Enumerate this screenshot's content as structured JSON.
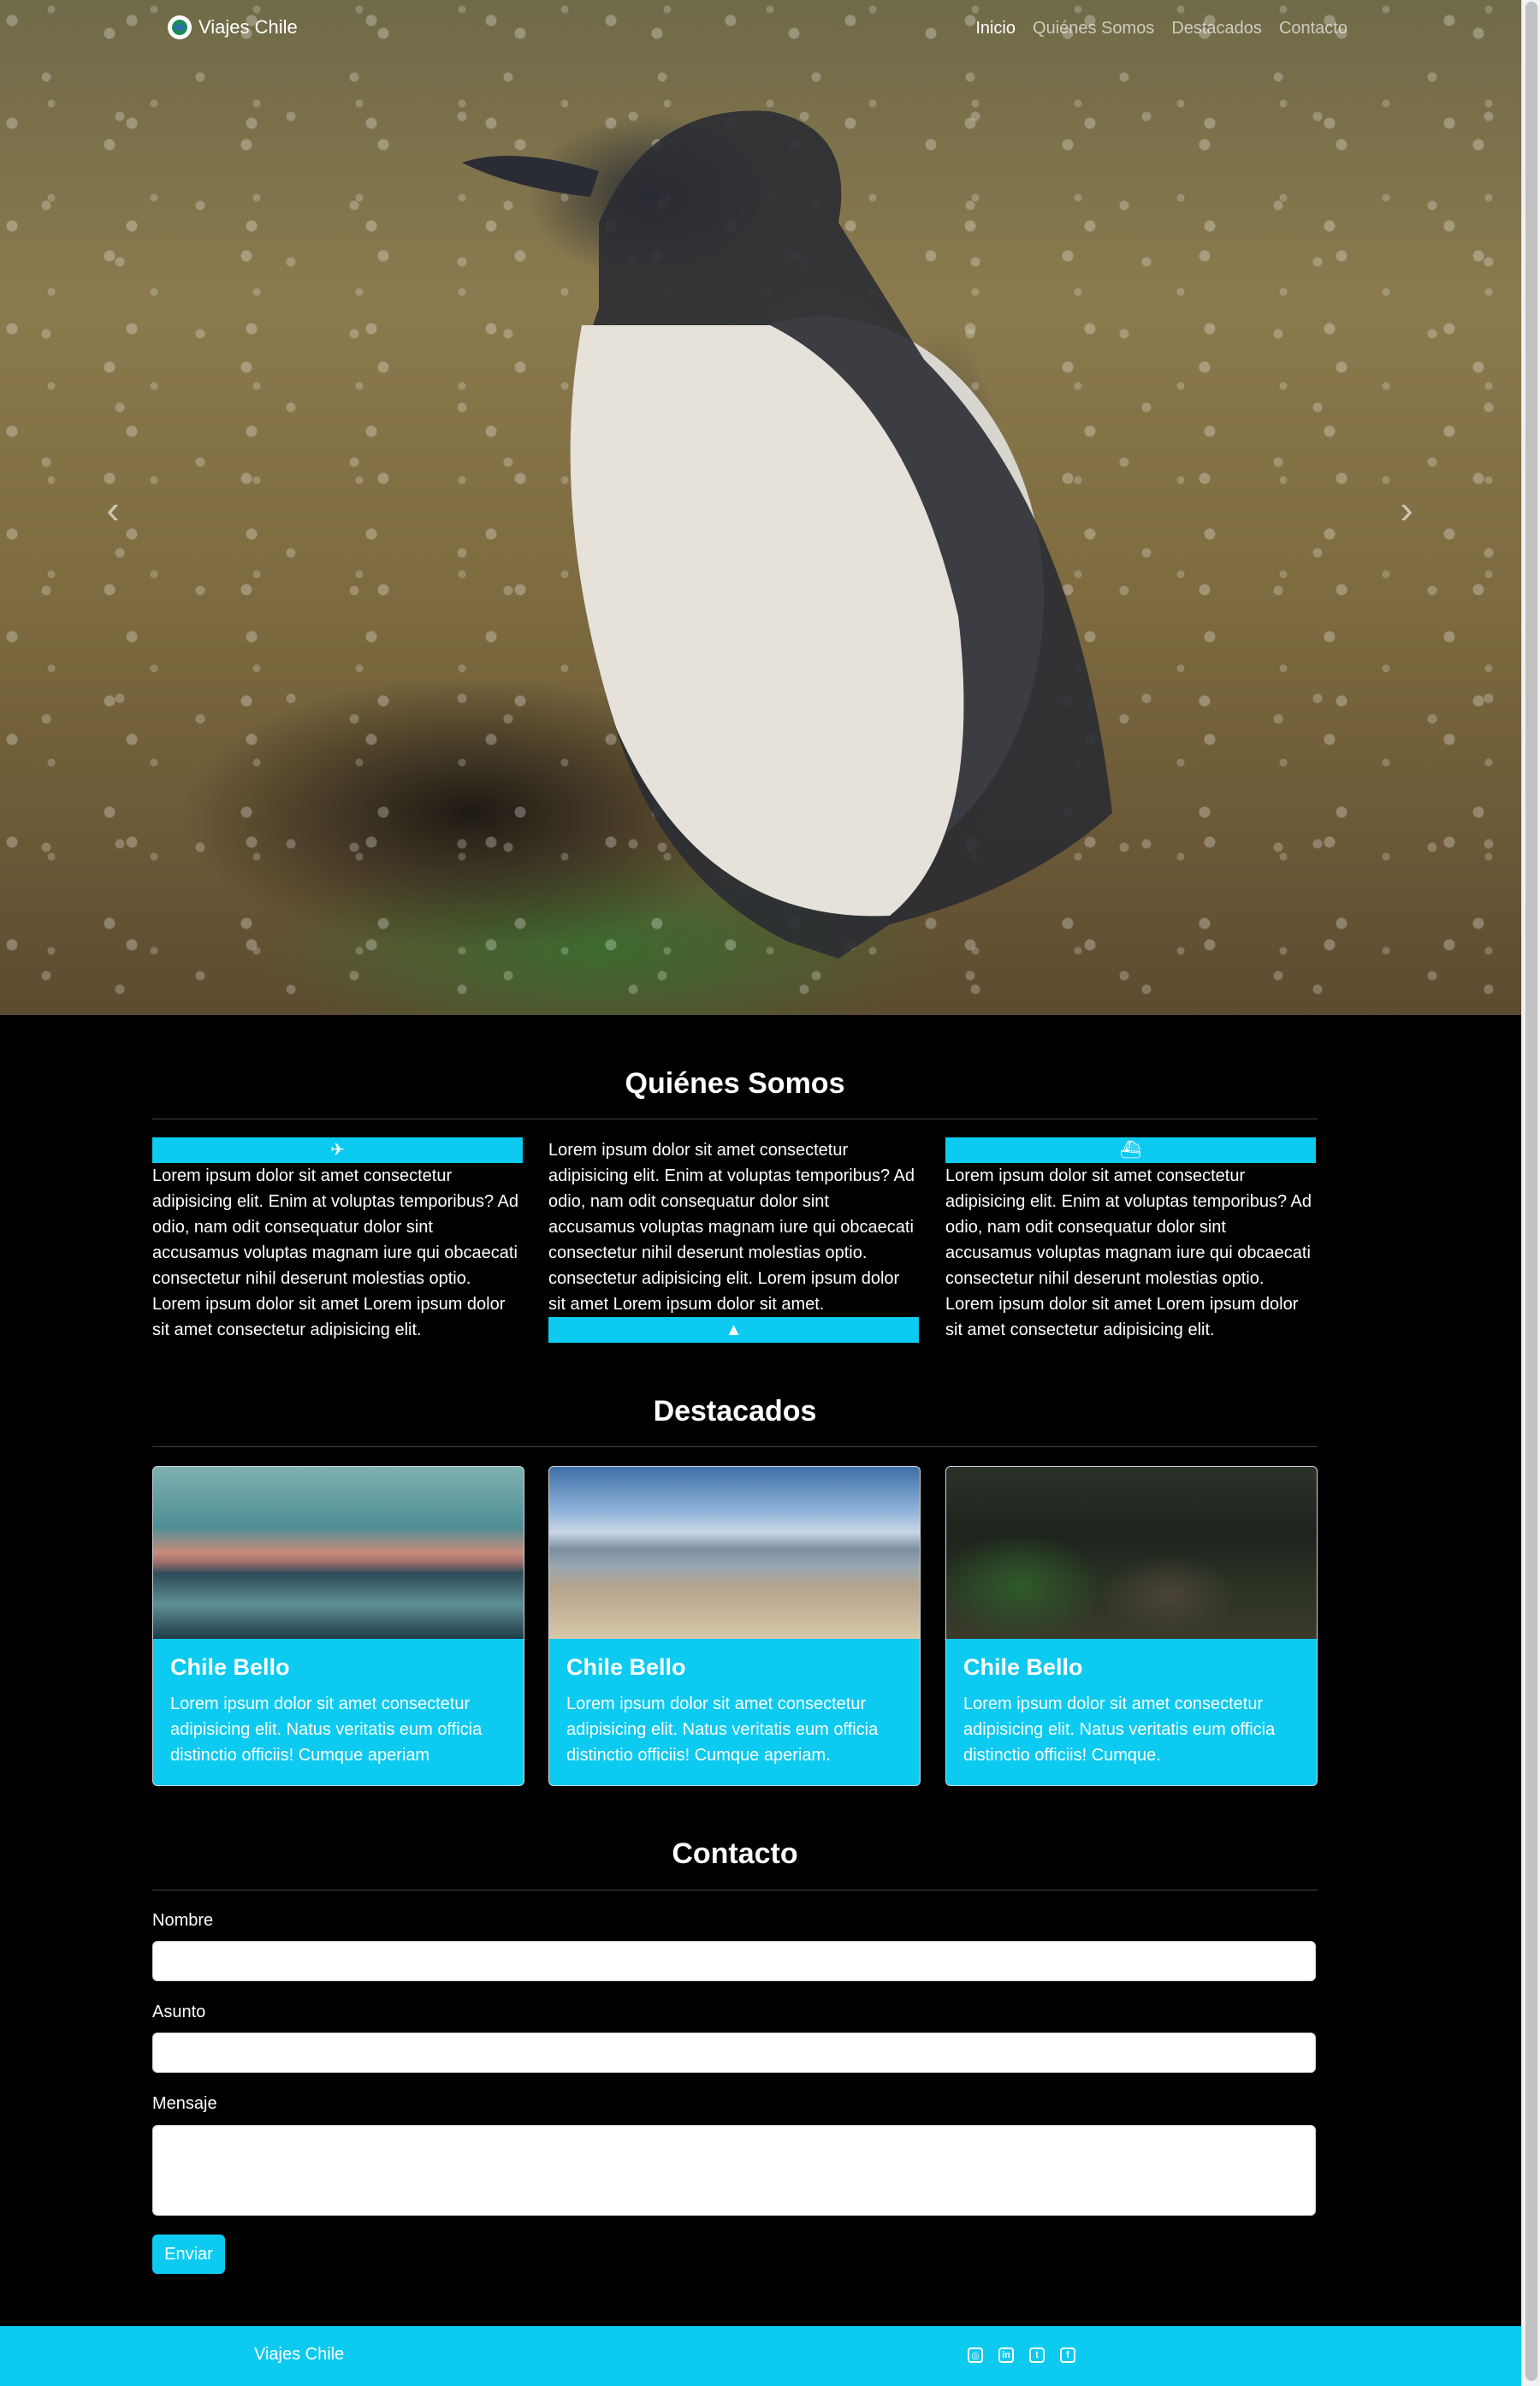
{
  "nav": {
    "brand": "Viajes Chile",
    "links": [
      "Inicio",
      "Quiénes Somos",
      "Destacados",
      "Contacto"
    ]
  },
  "hero": {
    "prev_label": "‹",
    "next_label": "›"
  },
  "about": {
    "title": "Quiénes Somos",
    "col1_icon": "airplane-icon",
    "col1_text": "Lorem ipsum dolor sit amet consectetur adipisicing elit. Enim at voluptas temporibus? Ad odio, nam odit consequatur dolor sint accusamus voluptas magnam iure qui obcaecati consectetur nihil deserunt molestias optio. Lorem ipsum dolor sit amet Lorem ipsum dolor sit amet consectetur adipisicing elit.",
    "col2_text": "Lorem ipsum dolor sit amet consectetur adipisicing elit. Enim at voluptas temporibus? Ad odio, nam odit consequatur dolor sint accusamus voluptas magnam iure qui obcaecati consectetur nihil deserunt molestias optio. consectetur adipisicing elit. Lorem ipsum dolor sit amet Lorem ipsum dolor sit amet.",
    "col2_icon": "mountain-icon",
    "col3_icon": "cruise-ship-icon",
    "col3_text": "Lorem ipsum dolor sit amet consectetur adipisicing elit. Enim at voluptas temporibus? Ad odio, nam odit consequatur dolor sint accusamus voluptas magnam iure qui obcaecati consectetur nihil deserunt molestias optio. Lorem ipsum dolor sit amet Lorem ipsum dolor sit amet consectetur adipisicing elit."
  },
  "featured": {
    "title": "Destacados",
    "cards": [
      {
        "title": "Chile Bello",
        "text": "Lorem ipsum dolor sit amet consectetur adipisicing elit. Natus veritatis eum officia distinctio officiis! Cumque aperiam"
      },
      {
        "title": "Chile Bello",
        "text": "Lorem ipsum dolor sit amet consectetur adipisicing elit. Natus veritatis eum officia distinctio officiis! Cumque aperiam."
      },
      {
        "title": "Chile Bello",
        "text": "Lorem ipsum dolor sit amet consectetur adipisicing elit. Natus veritatis eum officia distinctio officiis! Cumque."
      }
    ]
  },
  "contact": {
    "title": "Contacto",
    "name_label": "Nombre",
    "subject_label": "Asunto",
    "message_label": "Mensaje",
    "submit_label": "Enviar"
  },
  "footer": {
    "brand": "Viajes Chile",
    "social": [
      "instagram-icon",
      "linkedin-icon",
      "twitter-icon",
      "facebook-icon"
    ]
  },
  "colors": {
    "accent": "#0dcaf0",
    "background": "#000000"
  }
}
